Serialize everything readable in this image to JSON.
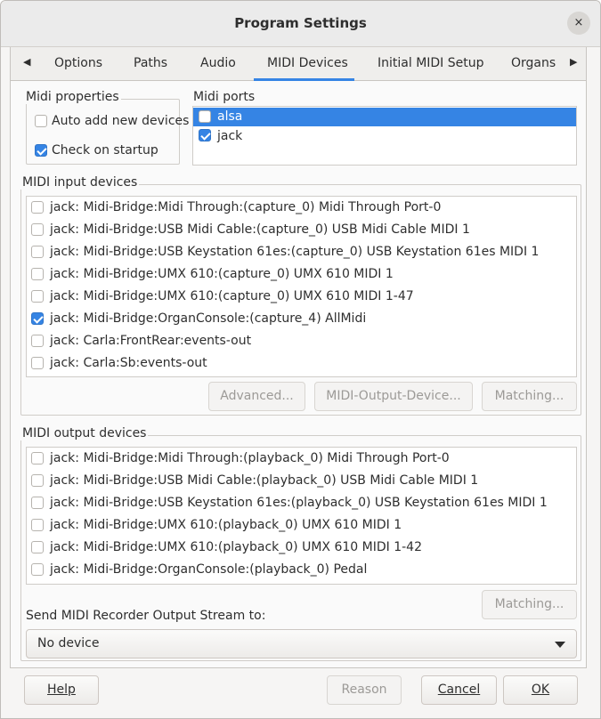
{
  "window": {
    "title": "Program Settings",
    "close_icon": "×"
  },
  "tabs": {
    "left_arrow": "◀",
    "right_arrow": "▶",
    "items": [
      "Options",
      "Paths",
      "Audio",
      "MIDI Devices",
      "Initial MIDI Setup",
      "Organs"
    ],
    "active": "MIDI Devices"
  },
  "midi_properties": {
    "label": "Midi properties",
    "auto_add": {
      "label": "Auto add new devices",
      "checked": false
    },
    "check_startup": {
      "label": "Check on startup",
      "checked": true
    }
  },
  "midi_ports": {
    "label": "Midi ports",
    "items": [
      {
        "label": "alsa",
        "checked": false,
        "selected": true
      },
      {
        "label": "jack",
        "checked": true,
        "selected": false
      }
    ]
  },
  "midi_input": {
    "label": "MIDI input devices",
    "items": [
      {
        "label": "jack: Midi-Bridge:Midi Through:(capture_0) Midi Through Port-0",
        "checked": false
      },
      {
        "label": "jack: Midi-Bridge:USB Midi Cable:(capture_0) USB Midi Cable MIDI 1",
        "checked": false
      },
      {
        "label": "jack: Midi-Bridge:USB Keystation 61es:(capture_0) USB Keystation 61es MIDI 1",
        "checked": false
      },
      {
        "label": "jack: Midi-Bridge:UMX 610:(capture_0) UMX 610 MIDI 1",
        "checked": false
      },
      {
        "label": "jack: Midi-Bridge:UMX 610:(capture_0) UMX 610 MIDI 1-47",
        "checked": false
      },
      {
        "label": "jack: Midi-Bridge:OrganConsole:(capture_4) AllMidi",
        "checked": true
      },
      {
        "label": "jack: Carla:FrontRear:events-out",
        "checked": false
      },
      {
        "label": "jack: Carla:Sb:events-out",
        "checked": false
      }
    ],
    "buttons": {
      "advanced": "Advanced...",
      "midi_output_device": "MIDI-Output-Device...",
      "matching": "Matching..."
    }
  },
  "midi_output": {
    "label": "MIDI output devices",
    "items": [
      {
        "label": "jack: Midi-Bridge:Midi Through:(playback_0) Midi Through Port-0",
        "checked": false
      },
      {
        "label": "jack: Midi-Bridge:USB Midi Cable:(playback_0) USB Midi Cable MIDI 1",
        "checked": false
      },
      {
        "label": "jack: Midi-Bridge:USB Keystation 61es:(playback_0) USB Keystation 61es MIDI 1",
        "checked": false
      },
      {
        "label": "jack: Midi-Bridge:UMX 610:(playback_0) UMX 610 MIDI 1",
        "checked": false
      },
      {
        "label": "jack: Midi-Bridge:UMX 610:(playback_0) UMX 610 MIDI 1-42",
        "checked": false
      },
      {
        "label": "jack: Midi-Bridge:OrganConsole:(playback_0) Pedal",
        "checked": false
      }
    ],
    "matching": "Matching..."
  },
  "recorder": {
    "label": "Send MIDI Recorder Output Stream to:",
    "value": "No device"
  },
  "footer": {
    "help": "Help",
    "reason": "Reason",
    "cancel": "Cancel",
    "ok": "OK"
  },
  "colors": {
    "accent": "#3584e4",
    "window_bg": "#f6f5f4",
    "disabled_text": "#9c9a97"
  }
}
